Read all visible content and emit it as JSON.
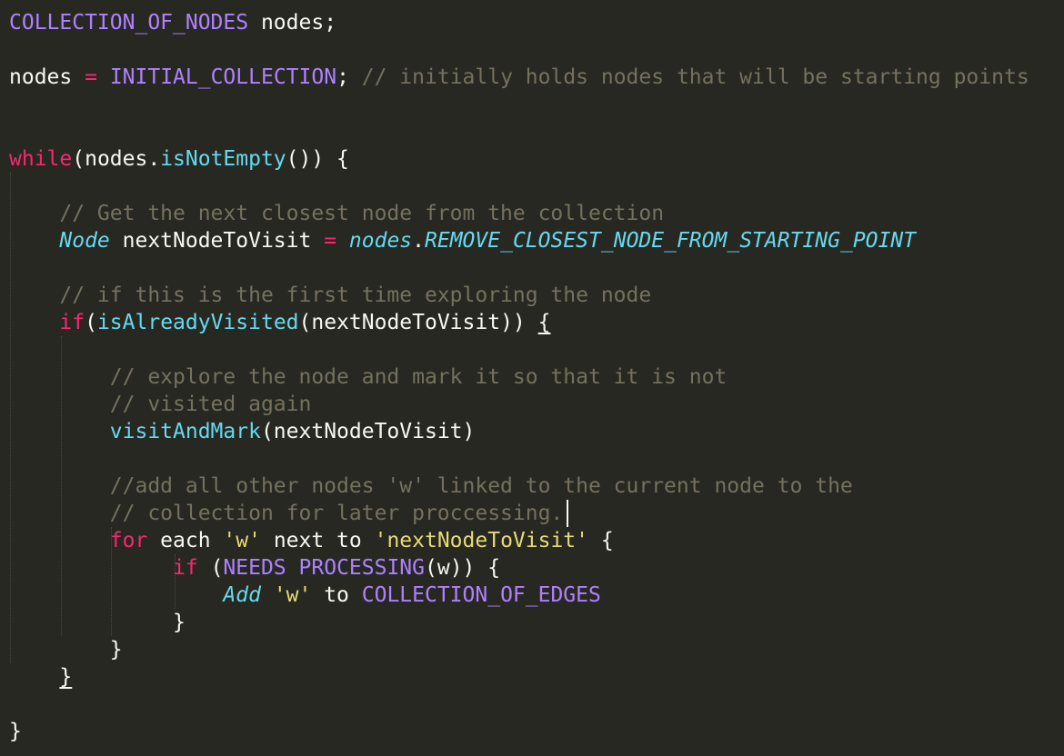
{
  "colors": {
    "background": "#272822",
    "default": "#f8f8f2",
    "constant": "#ae81ff",
    "keyword": "#f92672",
    "comment": "#75715e",
    "function": "#66d9ef",
    "string": "#e6db74"
  },
  "lines": [
    [
      {
        "t": "constant",
        "s": "COLLECTION_OF_NODES"
      },
      {
        "t": "default",
        "s": " nodes;"
      }
    ],
    [],
    [
      {
        "t": "default",
        "s": "nodes "
      },
      {
        "t": "operator",
        "s": "="
      },
      {
        "t": "default",
        "s": " "
      },
      {
        "t": "constant",
        "s": "INITIAL_COLLECTION"
      },
      {
        "t": "default",
        "s": "; "
      },
      {
        "t": "comment",
        "s": "// initially holds nodes that will be starting points"
      }
    ],
    [],
    [],
    [
      {
        "t": "keyword",
        "s": "while"
      },
      {
        "t": "default",
        "s": "(nodes."
      },
      {
        "t": "function",
        "s": "isNotEmpty"
      },
      {
        "t": "default",
        "s": "()) {"
      }
    ],
    [],
    [
      {
        "t": "default",
        "s": "    "
      },
      {
        "t": "comment",
        "s": "// Get the next closest node from the collection"
      }
    ],
    [
      {
        "t": "default",
        "s": "    "
      },
      {
        "t": "type",
        "s": "Node"
      },
      {
        "t": "default",
        "s": " nextNodeToVisit "
      },
      {
        "t": "operator",
        "s": "="
      },
      {
        "t": "default",
        "s": " "
      },
      {
        "t": "method-italic",
        "s": "nodes"
      },
      {
        "t": "default",
        "s": "."
      },
      {
        "t": "method-italic",
        "s": "REMOVE_CLOSEST_NODE_FROM_STARTING_POINT"
      }
    ],
    [],
    [
      {
        "t": "default",
        "s": "    "
      },
      {
        "t": "comment",
        "s": "// if this is the first time exploring the node"
      }
    ],
    [
      {
        "t": "default",
        "s": "    "
      },
      {
        "t": "keyword",
        "s": "if"
      },
      {
        "t": "default",
        "s": "("
      },
      {
        "t": "function",
        "s": "isAlreadyVisited"
      },
      {
        "t": "default",
        "s": "(nextNodeToVisit)) "
      },
      {
        "t": "bracket-match",
        "s": "{"
      }
    ],
    [],
    [
      {
        "t": "default",
        "s": "        "
      },
      {
        "t": "comment",
        "s": "// explore the node and mark it so that it is not"
      }
    ],
    [
      {
        "t": "default",
        "s": "        "
      },
      {
        "t": "comment",
        "s": "// visited again"
      }
    ],
    [
      {
        "t": "default",
        "s": "        "
      },
      {
        "t": "function",
        "s": "visitAndMark"
      },
      {
        "t": "default",
        "s": "(nextNodeToVisit)"
      }
    ],
    [],
    [
      {
        "t": "default",
        "s": "        "
      },
      {
        "t": "comment",
        "s": "//add all other nodes 'w' linked to the current node to the"
      }
    ],
    [
      {
        "t": "default",
        "s": "        "
      },
      {
        "t": "comment",
        "s": "// collection for later proccessing."
      }
    ],
    [
      {
        "t": "default",
        "s": "        "
      },
      {
        "t": "keyword",
        "s": "for"
      },
      {
        "t": "default",
        "s": " each "
      },
      {
        "t": "string",
        "s": "'w'"
      },
      {
        "t": "default",
        "s": " next to "
      },
      {
        "t": "string",
        "s": "'nextNodeToVisit'"
      },
      {
        "t": "default",
        "s": " {"
      }
    ],
    [
      {
        "t": "default",
        "s": "             "
      },
      {
        "t": "keyword",
        "s": "if"
      },
      {
        "t": "default",
        "s": " ("
      },
      {
        "t": "constant",
        "s": "NEEDS"
      },
      {
        "t": "default",
        "s": " "
      },
      {
        "t": "constant",
        "s": "PROCESSING"
      },
      {
        "t": "default",
        "s": "(w)) {"
      }
    ],
    [
      {
        "t": "default",
        "s": "                 "
      },
      {
        "t": "type",
        "s": "Add"
      },
      {
        "t": "default",
        "s": " "
      },
      {
        "t": "string",
        "s": "'w'"
      },
      {
        "t": "default",
        "s": " to "
      },
      {
        "t": "constant",
        "s": "COLLECTION_OF_EDGES"
      }
    ],
    [
      {
        "t": "default",
        "s": "             }"
      }
    ],
    [
      {
        "t": "default",
        "s": "        }"
      }
    ],
    [
      {
        "t": "default",
        "s": "    "
      },
      {
        "t": "bracket-match",
        "s": "}"
      }
    ],
    [],
    [
      {
        "t": "default",
        "s": "}"
      }
    ]
  ]
}
